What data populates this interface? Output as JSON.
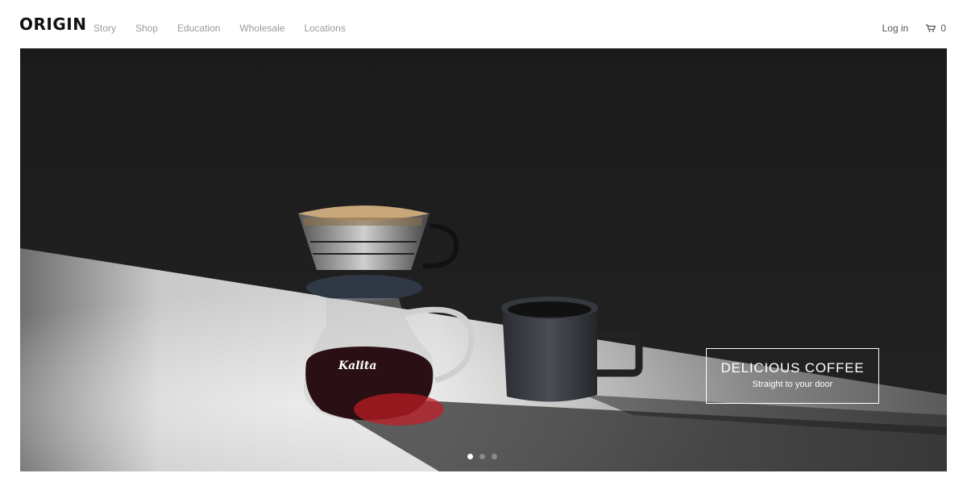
{
  "header": {
    "logo": "ORIGIN",
    "nav": [
      {
        "label": "Story"
      },
      {
        "label": "Shop"
      },
      {
        "label": "Education"
      },
      {
        "label": "Wholesale"
      },
      {
        "label": "Locations"
      }
    ],
    "login_label": "Log in",
    "cart_count": "0",
    "cart_icon": "cart-icon"
  },
  "hero": {
    "callout_title": "DELICIOUS COFFEE",
    "callout_subtitle": "Straight to your door",
    "slides_total": 3,
    "active_slide": 1,
    "kettle_brand": "Kalita"
  },
  "colors": {
    "header_bg": "#ffffff",
    "nav_text": "#9a9a9a",
    "hero_dark": "#1c1c1c",
    "callout_border": "#ffffff"
  }
}
